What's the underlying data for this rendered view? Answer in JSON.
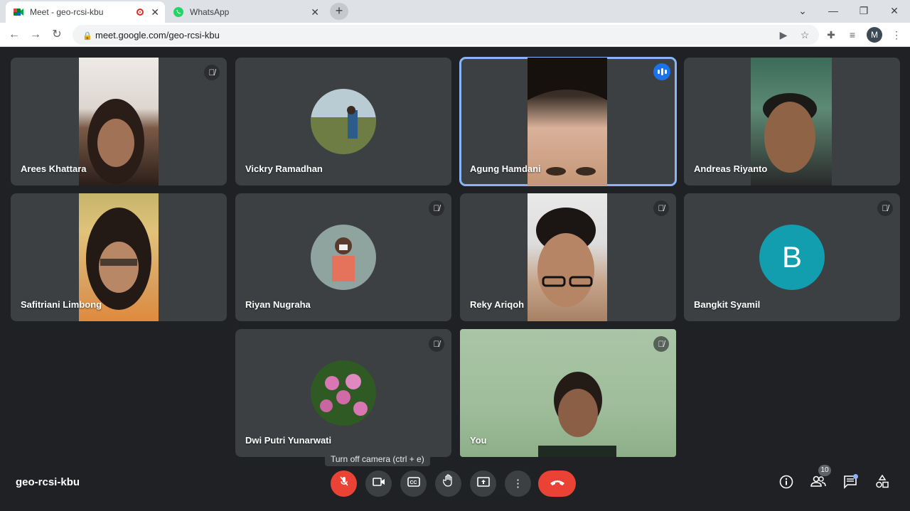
{
  "browser": {
    "tabs": [
      {
        "title": "Meet - geo-rcsi-kbu",
        "active": true,
        "recording": true
      },
      {
        "title": "WhatsApp",
        "active": false
      }
    ],
    "url": "meet.google.com/geo-rcsi-kbu",
    "profile_initial": "M"
  },
  "meeting": {
    "code": "geo-rcsi-kbu",
    "participant_count": "10",
    "tooltip": "Turn off camera (ctrl + e)"
  },
  "participants": [
    {
      "name": "Arees Khattara",
      "muted": true,
      "mode": "video"
    },
    {
      "name": "Vickry Ramadhan",
      "muted": false,
      "mode": "photo"
    },
    {
      "name": "Agung Hamdani",
      "muted": false,
      "speaking": true,
      "mode": "video"
    },
    {
      "name": "Andreas Riyanto",
      "muted": false,
      "mode": "video"
    },
    {
      "name": "Safitriani Limbong",
      "muted": false,
      "mode": "video"
    },
    {
      "name": "Riyan Nugraha",
      "muted": true,
      "mode": "photo"
    },
    {
      "name": "Reky Ariqoh",
      "muted": true,
      "mode": "video"
    },
    {
      "name": "Bangkit Syamil",
      "muted": true,
      "mode": "letter",
      "initial": "B"
    },
    {
      "name": "Dwi Putri Yunarwati",
      "muted": true,
      "mode": "photo"
    },
    {
      "name": "You",
      "muted": true,
      "mode": "video"
    }
  ],
  "colors": {
    "background": "#202124",
    "tile": "#3c4043",
    "danger": "#ea4335",
    "speaking_outline": "#8ab4f8",
    "letter_avatar": "#129eaf"
  }
}
